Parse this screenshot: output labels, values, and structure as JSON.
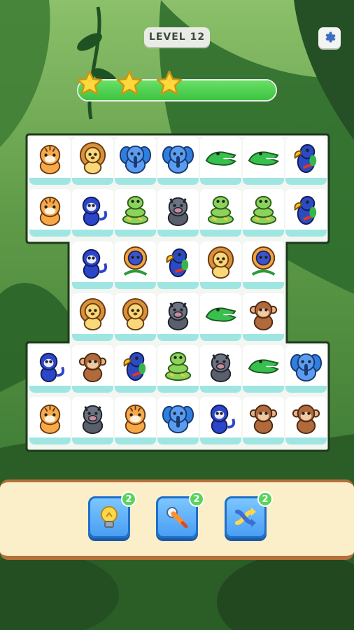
{
  "header": {
    "level_label": "LEVEL 12",
    "settings_icon": "gear-icon",
    "stars_earned": 3,
    "progress_percent": 100
  },
  "board": {
    "tile_grid": [
      [
        "tiger",
        "lion",
        "elephant",
        "elephant",
        "crocodile",
        "crocodile",
        "parrot"
      ],
      [
        "tiger",
        "monkey-blue",
        "snake",
        "boar",
        "snake",
        "snake",
        "parrot"
      ],
      [
        null,
        "monkey-blue",
        "lion-blue",
        "parrot",
        "lion",
        "lion-blue",
        null
      ],
      [
        null,
        "lion",
        "lion",
        "boar",
        "crocodile",
        "monkey-brown",
        null
      ],
      [
        "monkey-blue",
        "monkey-brown",
        "parrot",
        "snake",
        "boar",
        "crocodile",
        "elephant"
      ],
      [
        "tiger",
        "boar",
        "tiger",
        "elephant",
        "monkey-blue",
        "monkey-brown",
        "monkey-brown"
      ]
    ]
  },
  "powerups": [
    {
      "name": "hint",
      "icon": "lightbulb-icon",
      "count": "2"
    },
    {
      "name": "bomb",
      "icon": "rocket-icon",
      "count": "2"
    },
    {
      "name": "shuffle",
      "icon": "shuffle-icon",
      "count": "2"
    }
  ],
  "colors": {
    "background": "#2f6b2c",
    "progress_fill": "#4fd04d",
    "tile_base": "#9fe6e2",
    "powerup_button": "#4a9ef3",
    "badge": "#5bd35a",
    "tray": "#fbefc9"
  }
}
